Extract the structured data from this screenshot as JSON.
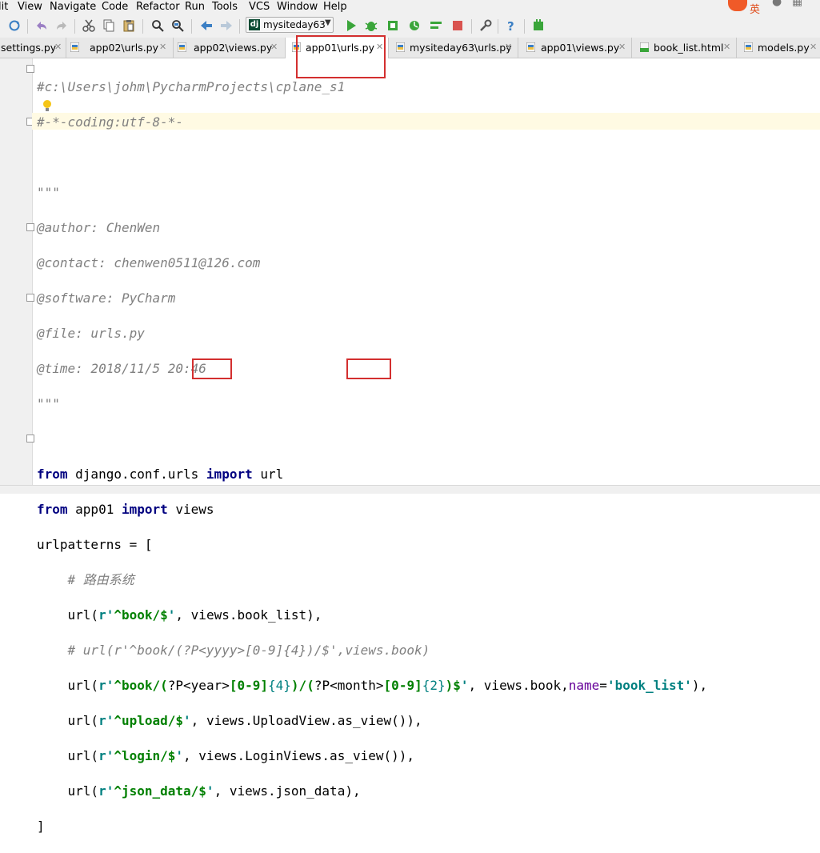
{
  "menu": [
    "lit",
    "View",
    "Navigate",
    "Code",
    "Refactor",
    "Run",
    "Tools",
    "VCS",
    "Window",
    "Help"
  ],
  "toolbar": {
    "run_config": "mysiteday63",
    "icons": [
      "sync-icon",
      "undo-icon",
      "redo-icon",
      "cut-icon",
      "copy-icon",
      "paste-icon",
      "find-icon",
      "replace-icon",
      "back-icon",
      "forward-icon",
      "run-icon",
      "debug-icon",
      "coverage-icon",
      "profile-icon",
      "concurrency-icon",
      "stop-icon",
      "settings-icon",
      "help-icon",
      "plugin-icon"
    ]
  },
  "brand": {
    "text": "英"
  },
  "tabs": [
    {
      "label": "settings.py"
    },
    {
      "label": "app02\\urls.py"
    },
    {
      "label": "app02\\views.py"
    },
    {
      "label": "app01\\urls.py",
      "active": true
    },
    {
      "label": "mysiteday63\\urls.py"
    },
    {
      "label": "app01\\views.py"
    },
    {
      "label": "book_list.html"
    },
    {
      "label": "models.py"
    }
  ],
  "code": {
    "l1": "#c:\\Users\\johm\\PycharmProjects\\cplane_s1",
    "l2": "#-*-coding:utf-8-*-",
    "l4": "\"\"\"",
    "l5": "@author: ChenWen",
    "l6": "@contact: chenwen0511@126.com",
    "l7": "@software: PyCharm",
    "l8": "@file: urls.py",
    "l9": "@time: 2018/11/5 20:46",
    "l10": "\"\"\"",
    "l12_kw1": "from",
    "l12_mod": " django.conf.urls ",
    "l12_kw2": "import",
    "l12_name": " url",
    "l13_kw1": "from",
    "l13_mod": " app01 ",
    "l13_kw2": "import",
    "l13_name": " views",
    "l14": "urlpatterns = [",
    "l15": "    # 路由系统",
    "l16_a": "    url(",
    "l16_r": "r'",
    "l16_rx": "^book/$",
    "l16_q": "'",
    "l16_b": ", views.book_list),",
    "l17": "    # url(r'^book/(?P<yyyy>[0-9]{4})/$',views.book)",
    "l18_a": "    url(",
    "l18_r": "r'",
    "l18_rx1": "^book/(",
    "l18_p1": "?P<",
    "l18_g1": "year",
    "l18_p2": ">",
    "l18_rx2": "[0-9]",
    "l18_q1": "{4}",
    "l18_rx3": ")/(",
    "l18_p3": "?P<",
    "l18_g2": "month",
    "l18_p4": ">",
    "l18_rx4": "[0-9]",
    "l18_q2": "{2}",
    "l18_rx5": ")$",
    "l18_q": "'",
    "l18_b": ", views.book,",
    "l18_kw": "name",
    "l18_eq": "=",
    "l18_s": "'book_list'",
    "l18_c": "),",
    "l19_a": "    url(",
    "l19_r": "r'",
    "l19_rx": "^upload/$",
    "l19_q": "'",
    "l19_b": ", views.UploadView.as_view()),",
    "l20_a": "    url(",
    "l20_r": "r'",
    "l20_rx": "^login/$",
    "l20_q": "'",
    "l20_b": ", views.LoginViews.as_view()),",
    "l21_a": "    url(",
    "l21_r": "r'",
    "l21_rx": "^json_data/$",
    "l21_q": "'",
    "l21_b": ", views.json_data),",
    "l22": "]"
  },
  "colors": {
    "highlight_box": "#d32f2f",
    "caret_line": "#fffae3"
  }
}
